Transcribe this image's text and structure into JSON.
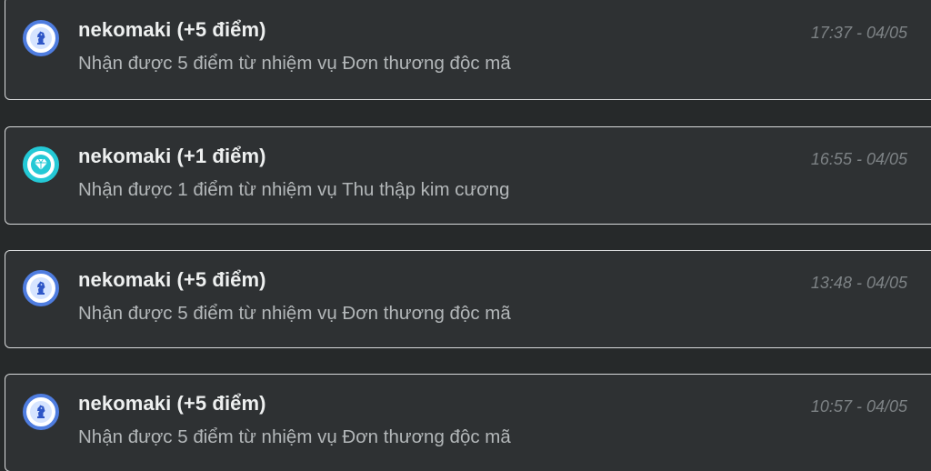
{
  "notifications": [
    {
      "title": "nekomaki (+5 điểm)",
      "message": "Nhận được 5 điểm từ nhiệm vụ Đơn thương độc mã",
      "time": "17:37 - 04/05",
      "icon": "knight-icon"
    },
    {
      "title": "nekomaki (+1 điểm)",
      "message": "Nhận được 1 điểm từ nhiệm vụ Thu thập kim cương",
      "time": "16:55 - 04/05",
      "icon": "diamond-icon"
    },
    {
      "title": "nekomaki (+5 điểm)",
      "message": "Nhận được 5 điểm từ nhiệm vụ Đơn thương độc mã",
      "time": "13:48 - 04/05",
      "icon": "knight-icon"
    },
    {
      "title": "nekomaki (+5 điểm)",
      "message": "Nhận được 5 điểm từ nhiệm vụ Đơn thương độc mã",
      "time": "10:57 - 04/05",
      "icon": "knight-icon"
    }
  ],
  "colors": {
    "background": "#26292a",
    "card": "#2e3133",
    "border": "#d8dadb",
    "knight_ring": "#4f7de0",
    "diamond_ring": "#24c9d6"
  }
}
